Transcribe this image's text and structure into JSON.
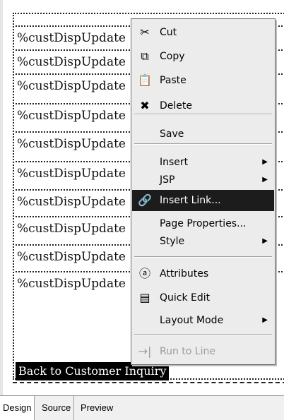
{
  "editor": {
    "rows": [
      "%custDispUpdate",
      "%custDispUpdate",
      "%custDispUpdate",
      "%custDispUpdate",
      "%custDispUpdate",
      "%custDispUpdate",
      "%custDispUpdate",
      "%custDispUpdate",
      "%custDispUpdate",
      "%custDispUpdate"
    ],
    "back_link": "Back to Customer Inquiry"
  },
  "context_menu": {
    "items": [
      {
        "label": "Cut",
        "icon": "scissors-icon"
      },
      {
        "label": "Copy",
        "icon": "copy-icon"
      },
      {
        "label": "Paste",
        "icon": "paste-icon"
      },
      {
        "label": "Delete",
        "icon": "delete-icon"
      },
      {
        "label": "Save"
      },
      {
        "label": "Insert",
        "submenu": true
      },
      {
        "label": "JSP",
        "submenu": true
      },
      {
        "label": "Insert Link...",
        "icon": "link-icon",
        "highlighted": true
      },
      {
        "label": "Page Properties..."
      },
      {
        "label": "Style",
        "submenu": true
      },
      {
        "label": "Attributes",
        "icon": "attributes-icon"
      },
      {
        "label": "Quick Edit",
        "icon": "quick-edit-icon"
      },
      {
        "label": "Layout Mode",
        "submenu": true
      },
      {
        "label": "Run to Line",
        "icon": "run-to-line-icon",
        "disabled": true
      }
    ]
  },
  "tabs": [
    "Design",
    "Source",
    "Preview"
  ]
}
